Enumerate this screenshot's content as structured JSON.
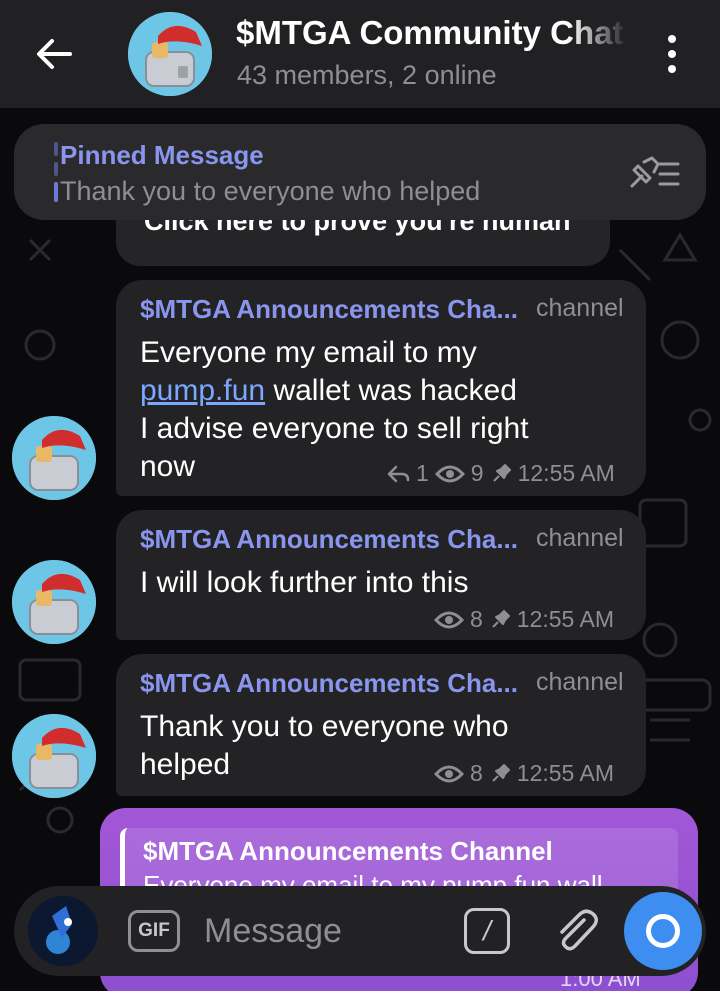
{
  "header": {
    "title": "$MTGA Community Chat",
    "subtitle": "43 members, 2 online"
  },
  "pinned": {
    "label": "Pinned Message",
    "text": "Thank you to everyone who helped"
  },
  "captcha_bubble": {
    "text": "Click here to prove you're human"
  },
  "messages": [
    {
      "sender": "$MTGA Announcements Cha...",
      "tag": "channel",
      "text_before_link": "Everyone my email to my",
      "link": "pump.fun",
      "text_after_link": "wallet was hacked",
      "text_line3": "I advise everyone to sell right",
      "text_line4": "now",
      "replies": "1",
      "views": "9",
      "time": "12:55 AM"
    },
    {
      "sender": "$MTGA Announcements Cha...",
      "tag": "channel",
      "text": "I will look further into this",
      "views": "8",
      "time": "12:55 AM"
    },
    {
      "sender": "$MTGA Announcements Cha...",
      "tag": "channel",
      "text_line1": "Thank you to everyone who",
      "text_line2": "helped",
      "views": "8",
      "time": "12:55 AM"
    }
  ],
  "own_message": {
    "reply_title": "$MTGA Announcements Channel",
    "reply_text": "Everyone my email to my pump.fun wall",
    "time": "1:00 AM"
  },
  "input": {
    "gif_label": "GIF",
    "placeholder": "Message",
    "command_label": "/"
  },
  "colors": {
    "accent": "#8a95ee",
    "own_bubble": "#9a54d4",
    "camera": "#3d8ef0",
    "bubble": "#232326"
  },
  "icons": [
    "back-arrow-icon",
    "more-vertical-icon",
    "pin-list-icon",
    "reply-icon",
    "eye-icon",
    "pin-icon",
    "paperclip-icon",
    "camera-icon"
  ]
}
